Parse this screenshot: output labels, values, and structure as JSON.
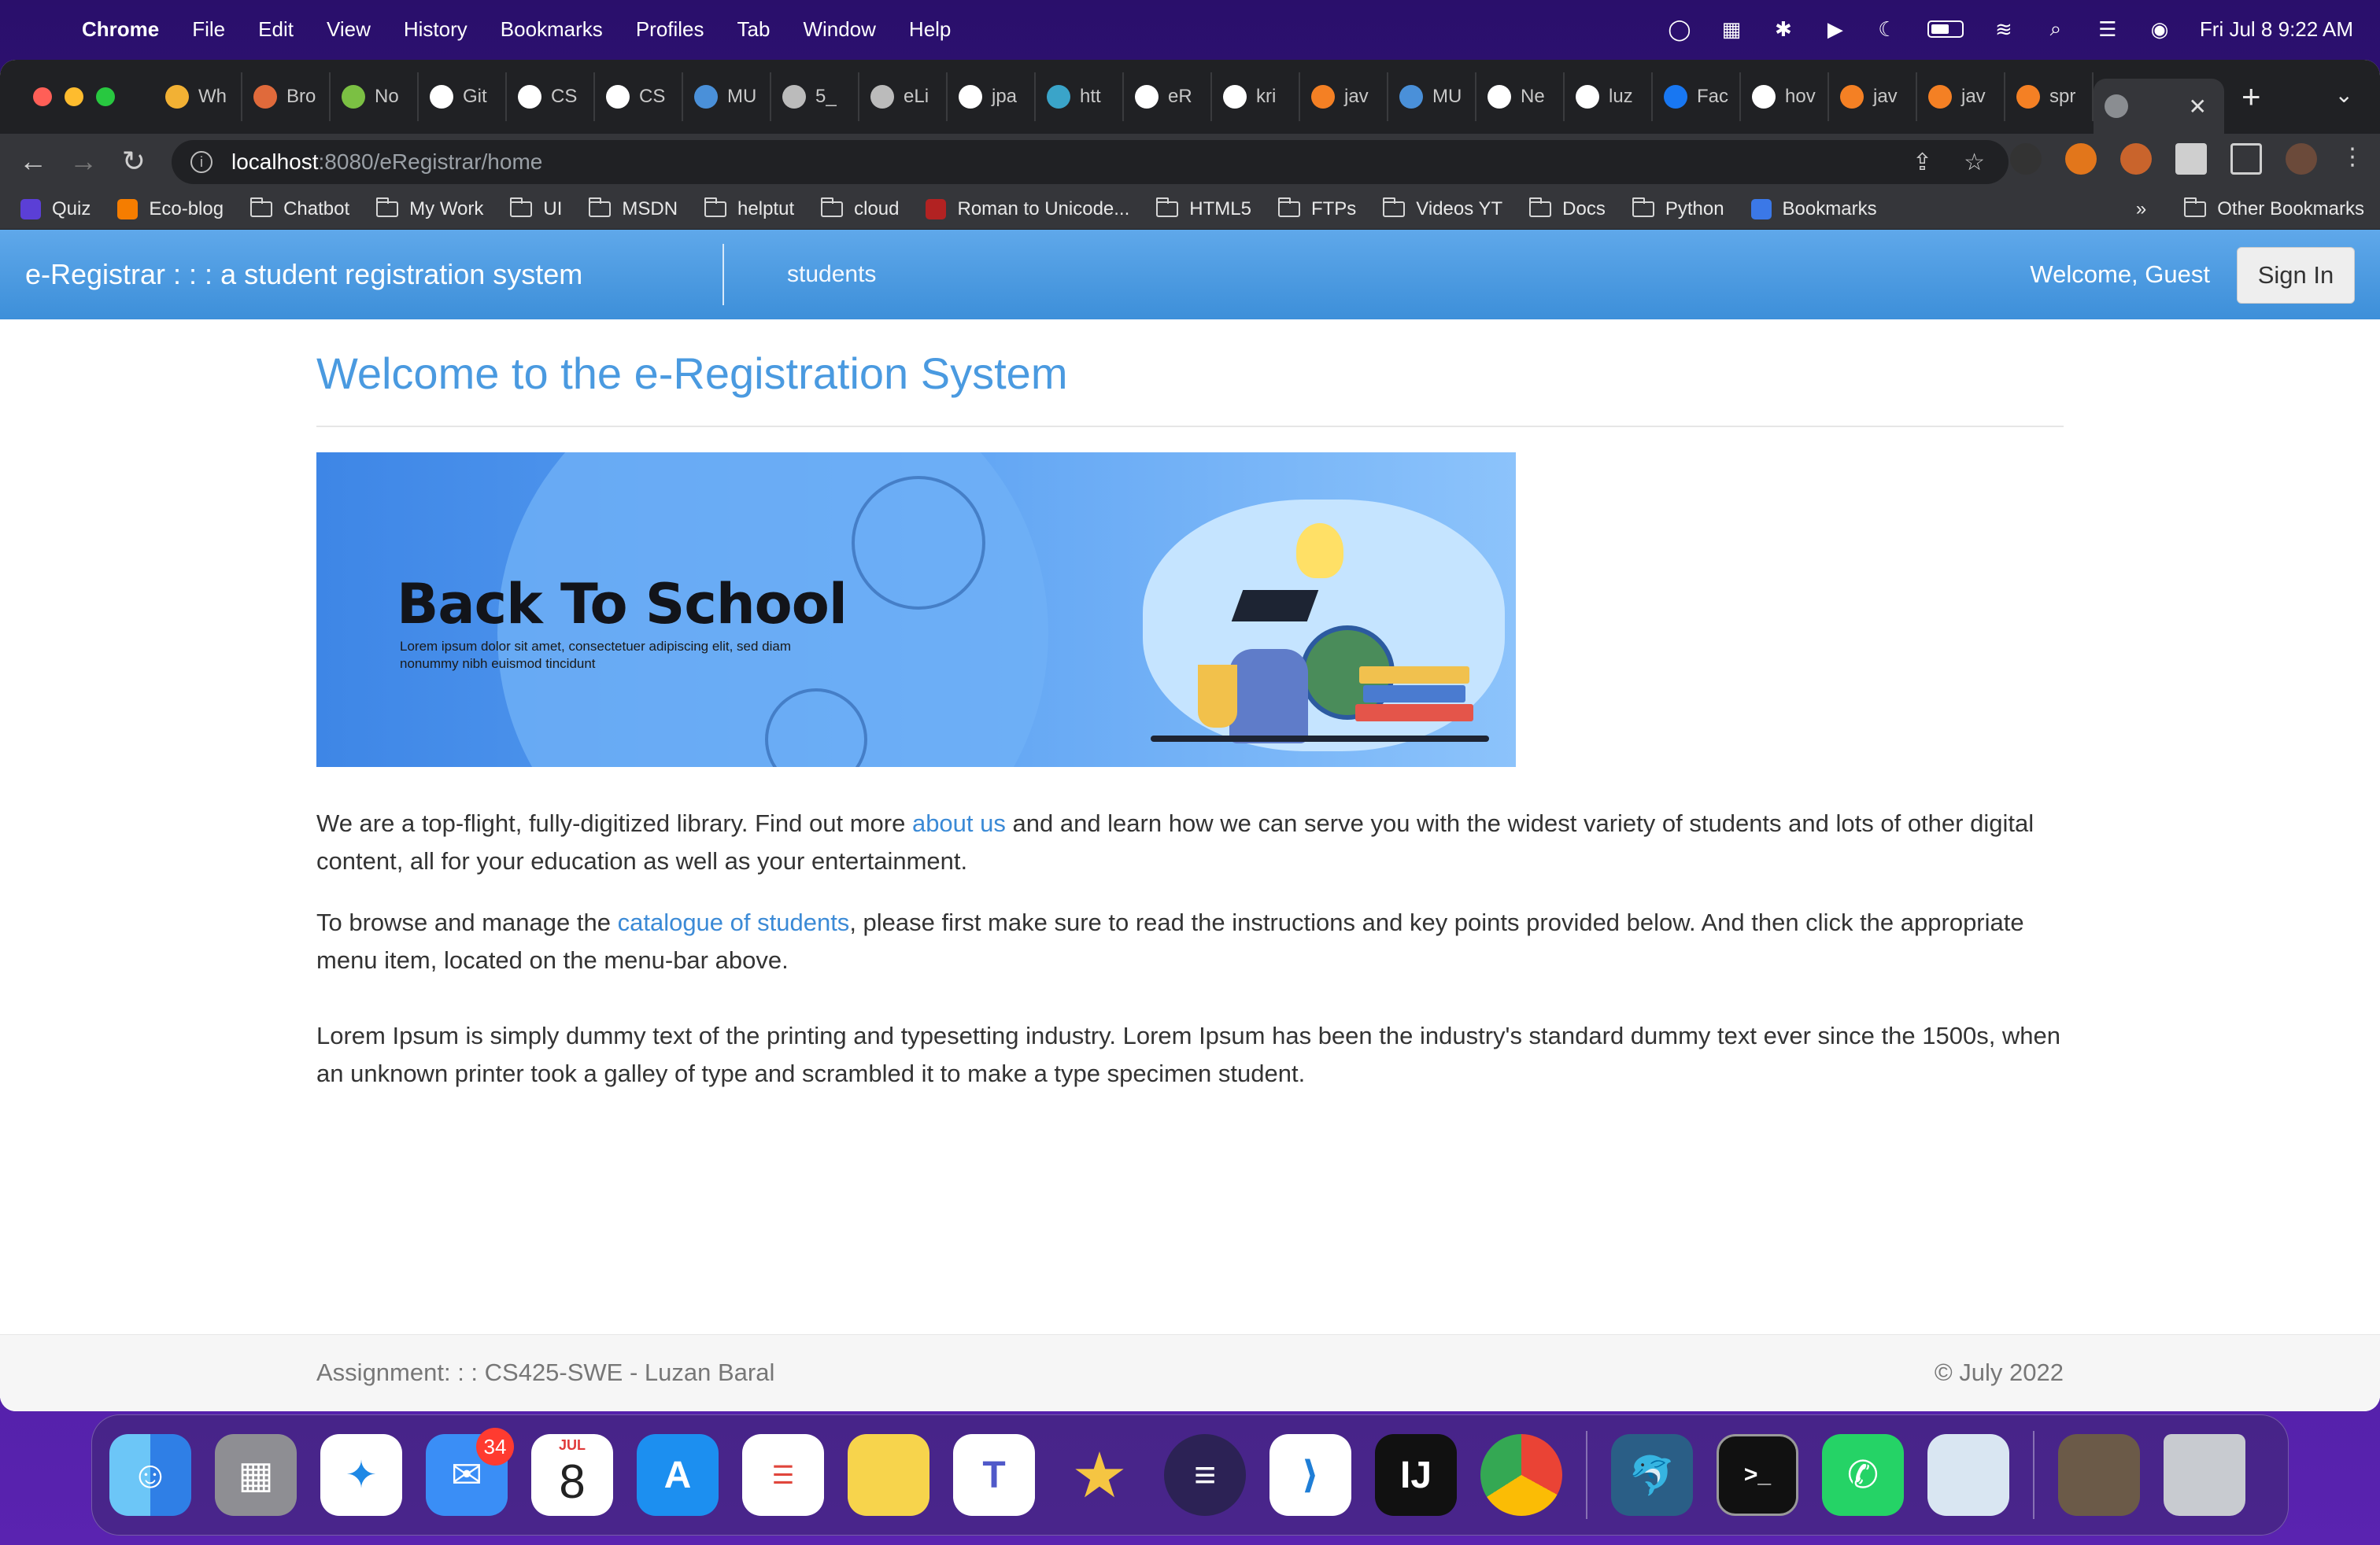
{
  "menubar": {
    "app_name": "Chrome",
    "items": [
      "File",
      "Edit",
      "View",
      "History",
      "Bookmarks",
      "Profiles",
      "Tab",
      "Window",
      "Help"
    ],
    "datetime": "Fri Jul 8  9:22 AM"
  },
  "tabs": [
    {
      "label": "Wh",
      "color": "#f2b134"
    },
    {
      "label": "Bro",
      "color": "#e06a3b"
    },
    {
      "label": "No",
      "color": "#7bc043"
    },
    {
      "label": "Git",
      "color": "#ffffff"
    },
    {
      "label": "CS",
      "color": "#ffffff"
    },
    {
      "label": "CS",
      "color": "#ffffff"
    },
    {
      "label": "MU",
      "color": "#4a90d9"
    },
    {
      "label": "5_",
      "color": "#bbbbbb"
    },
    {
      "label": "eLi",
      "color": "#bbbbbb"
    },
    {
      "label": "jpa",
      "color": "#ffffff"
    },
    {
      "label": "htt",
      "color": "#3aa4c9"
    },
    {
      "label": "eR",
      "color": "#ffffff"
    },
    {
      "label": "kri",
      "color": "#ffffff"
    },
    {
      "label": "jav",
      "color": "#f48024"
    },
    {
      "label": "MU",
      "color": "#4a90d9"
    },
    {
      "label": "Ne",
      "color": "#ffffff"
    },
    {
      "label": "luz",
      "color": "#ffffff"
    },
    {
      "label": "Fac",
      "color": "#1877f2"
    },
    {
      "label": "hov",
      "color": "#ffffff"
    },
    {
      "label": "jav",
      "color": "#f48024"
    },
    {
      "label": "jav",
      "color": "#f48024"
    },
    {
      "label": "spr",
      "color": "#f48024"
    }
  ],
  "active_tab_close": "✕",
  "address": {
    "host": "localhost",
    "path": ":8080/eRegistrar/home"
  },
  "bookmarks": [
    {
      "label": "Quiz",
      "icon": "quiz-icon"
    },
    {
      "label": "Eco-blog",
      "icon": "blogger-icon"
    },
    {
      "label": "Chatbot",
      "icon": "folder-icon"
    },
    {
      "label": "My Work",
      "icon": "folder-icon"
    },
    {
      "label": "UI",
      "icon": "folder-icon"
    },
    {
      "label": "MSDN",
      "icon": "folder-icon"
    },
    {
      "label": "helptut",
      "icon": "folder-icon"
    },
    {
      "label": "cloud",
      "icon": "folder-icon"
    },
    {
      "label": "Roman to Unicode...",
      "icon": "site-icon"
    },
    {
      "label": "HTML5",
      "icon": "folder-icon"
    },
    {
      "label": "FTPs",
      "icon": "folder-icon"
    },
    {
      "label": "Videos YT",
      "icon": "folder-icon"
    },
    {
      "label": "Docs",
      "icon": "folder-icon"
    },
    {
      "label": "Python",
      "icon": "folder-icon"
    },
    {
      "label": "Bookmarks",
      "icon": "star-icon"
    }
  ],
  "bookmarks_overflow": "»",
  "other_bookmarks": "Other Bookmarks",
  "app": {
    "brand": "e-Registrar : : : a student registration system",
    "nav_students": "students",
    "welcome": "Welcome, Guest",
    "signin": "Sign In"
  },
  "main": {
    "title": "Welcome to the e-Registration System",
    "banner": {
      "heading": "Back To School",
      "subtext": "Lorem ipsum dolor sit amet, consectetuer adipiscing elit, sed diam nonummy nibh euismod tincidunt"
    },
    "p1": {
      "before": "We are a top-flight, fully-digitized library. Find out more ",
      "link": "about us",
      "after": " and and learn how we can serve you with the widest variety of students and lots of other digital content, all for your education as well as your entertainment."
    },
    "p2": {
      "before": "To browse and manage the ",
      "link": "catalogue of students",
      "after": ", please first make sure to read the instructions and key points provided below. And then click the appropriate menu item, located on the menu-bar above."
    },
    "p3": "Lorem Ipsum is simply dummy text of the printing and typesetting industry. Lorem Ipsum has been the industry's standard dummy text ever since the 1500s, when an unknown printer took a galley of type and scrambled it to make a type specimen student."
  },
  "footer": {
    "left": "Assignment: : : CS425-SWE - Luzan Baral",
    "right": "© July 2022"
  },
  "dock": {
    "mail_badge": "34",
    "calendar_month": "JUL",
    "calendar_day": "8"
  }
}
